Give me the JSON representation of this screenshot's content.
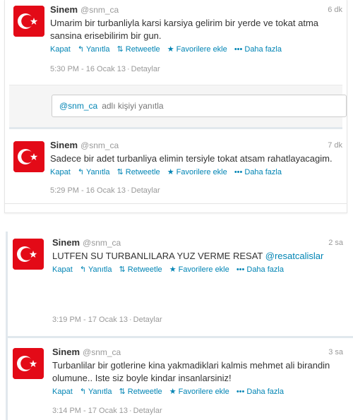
{
  "tweets": [
    {
      "name": "Sinem",
      "handle": "@snm_ca",
      "time": "6 dk",
      "text": "Umarim bir turbanliyla karsi karsiya gelirim bir yerde ve tokat atma sansina erisebilirim bir gun.",
      "timestamp": "5:30 PM - 16 Ocak 13",
      "details": "Detaylar"
    },
    {
      "name": "Sinem",
      "handle": "@snm_ca",
      "time": "7 dk",
      "text": "Sadece bir adet turbanliya elimin tersiyle tokat atsam rahatlayacagim.",
      "timestamp": "5:29 PM - 16 Ocak 13",
      "details": "Detaylar"
    },
    {
      "name": "Sinem",
      "handle": "@snm_ca",
      "time": "2 sa",
      "text": "LUTFEN SU TURBANLILARA YUZ VERME RESAT",
      "mention": "@resatcalislar",
      "timestamp": "3:19 PM - 17 Ocak 13",
      "details": "Detaylar"
    },
    {
      "name": "Sinem",
      "handle": "@snm_ca",
      "time": "3 sa",
      "text": "Turbanlilar bir gotlerine kina yakmadiklari kalmis mehmet ali birandin olumune.. Iste siz boyle kindar insanlarsiniz!",
      "timestamp": "3:14 PM - 17 Ocak 13",
      "details": "Detaylar"
    }
  ],
  "actions": {
    "close": "Kapat",
    "reply": "Yanıtla",
    "retweet": "Retweetle",
    "favorite": "Favorilere ekle",
    "more": "Daha fazla",
    "icons": {
      "reply": "reply-arrow-icon",
      "retweet": "retweet-icon",
      "favorite": "star-icon",
      "more": "dots-icon"
    }
  },
  "reply_box": {
    "mention": "@snm_ca",
    "placeholder": "adlı kişiyi yanıtla"
  },
  "colors": {
    "link": "#0084b4",
    "muted": "#999999",
    "avatar_red": "#e30a17"
  }
}
